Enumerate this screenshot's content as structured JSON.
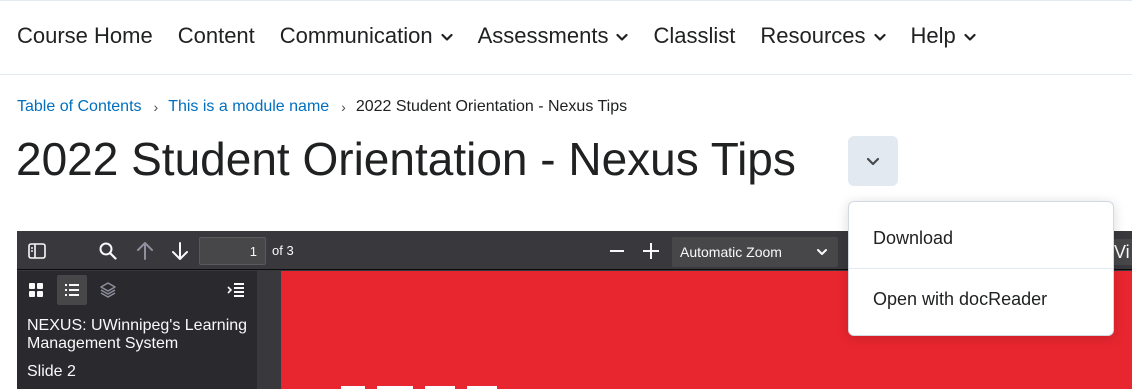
{
  "nav": {
    "items": [
      {
        "label": "Course Home",
        "dropdown": false
      },
      {
        "label": "Content",
        "dropdown": false
      },
      {
        "label": "Communication",
        "dropdown": true
      },
      {
        "label": "Assessments",
        "dropdown": true
      },
      {
        "label": "Classlist",
        "dropdown": false
      },
      {
        "label": "Resources",
        "dropdown": true
      },
      {
        "label": "Help",
        "dropdown": true
      }
    ]
  },
  "breadcrumb": {
    "items": [
      {
        "label": "Table of Contents"
      },
      {
        "label": "This is a module name"
      }
    ],
    "current": "2022 Student Orientation - Nexus Tips",
    "separator": "›"
  },
  "page": {
    "title": "2022 Student Orientation - Nexus Tips"
  },
  "menu": {
    "items": [
      {
        "label": "Download"
      },
      {
        "label": "Open with docReader"
      }
    ]
  },
  "viewer": {
    "current_page": "1",
    "page_count_label": "of 3",
    "zoom": "Automatic Zoom",
    "cut_off_button_label": "Vi",
    "outline": [
      {
        "label": "NEXUS: UWinnipeg's Learning Management System"
      },
      {
        "label": "Slide 2"
      }
    ],
    "slide_color": "#e8262f"
  },
  "colors": {
    "link": "#006fbf",
    "text": "#202122",
    "viewer_bg": "#38383d",
    "sidebar_bg": "#2a2a2e"
  }
}
